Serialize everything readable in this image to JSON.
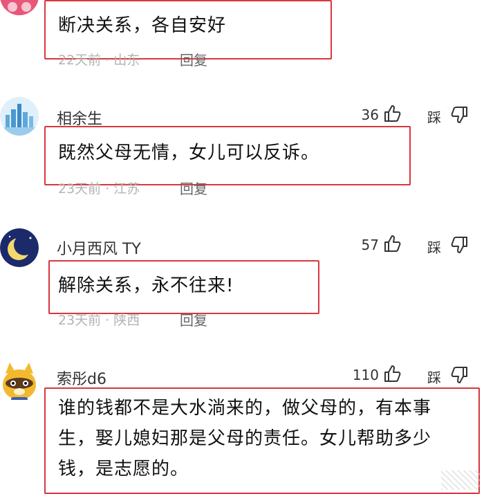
{
  "comments": [
    {
      "text": "断决关系，各自安好",
      "days": "22天前",
      "location": "山东",
      "reply_label": "回复"
    },
    {
      "username": "相余生",
      "likes": "36",
      "dislike_label": "踩",
      "text": "既然父母无情，女儿可以反诉。",
      "days": "23天前",
      "location": "江苏",
      "reply_label": "回复"
    },
    {
      "username": "小月西风 TY",
      "likes": "57",
      "dislike_label": "踩",
      "text": "解除关系，永不往来!",
      "days": "23天前",
      "location": "陕西",
      "reply_label": "回复"
    },
    {
      "username": "索彤d6",
      "likes": "110",
      "dislike_label": "踩",
      "text_lines": [
        "谁的钱都不是大水淌来的，做父母的，有本事",
        "生，娶儿媳妇那是父母的责任。女儿帮助多少",
        "钱，是志愿的。"
      ]
    }
  ],
  "separator": "·",
  "colors": {
    "highlight_border": "#d9363e",
    "meta_gray": "#b3b3b3"
  },
  "icons": {
    "like": "thumbs-up-icon",
    "dislike": "thumbs-down-icon"
  }
}
